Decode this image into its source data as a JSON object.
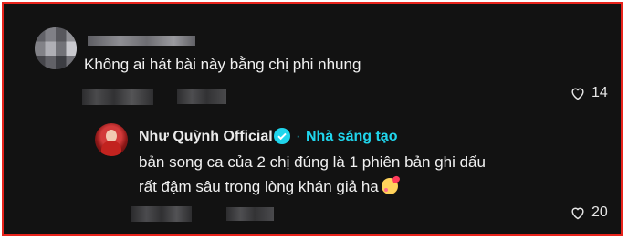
{
  "comment": {
    "text": "Không ai hát bài này bằng chị phi nhung",
    "likes": "14"
  },
  "reply": {
    "author": "Như Quỳnh Official",
    "badge": "Nhà sáng tạo",
    "separator": "·",
    "line1": "bản song ca của 2 chị đúng là 1 phiên bản ghi dấu",
    "line2": "rất đậm sâu trong lòng khán giả ha",
    "likes": "20"
  },
  "colors": {
    "accent": "#20d5ec",
    "border": "#e8241c",
    "background": "#121212"
  }
}
